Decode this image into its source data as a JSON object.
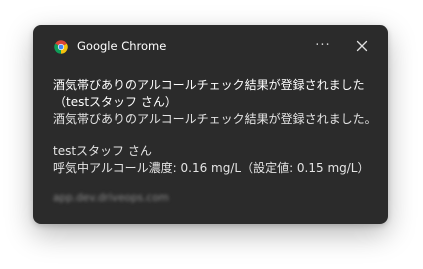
{
  "notification": {
    "app_name": "Google Chrome",
    "more_label": "···",
    "title_line1": "酒気帯びありのアルコールチェック結果が登録されました",
    "title_line2": "（testスタッフ さん）",
    "message_line1": "酒気帯びありのアルコールチェック結果が登録されました。",
    "message_line2": "testスタッフ さん",
    "message_line3": "呼気中アルコール濃度: 0.16 mg/L（設定値: 0.15 mg/L）",
    "attribution": "app.dev.driveops.com"
  },
  "colors": {
    "background": "#2b2b2b",
    "text": "#ffffff",
    "secondary_text": "#8a8a8a"
  },
  "icons": {
    "app": "chrome-icon",
    "more": "more-icon",
    "close": "close-icon"
  }
}
